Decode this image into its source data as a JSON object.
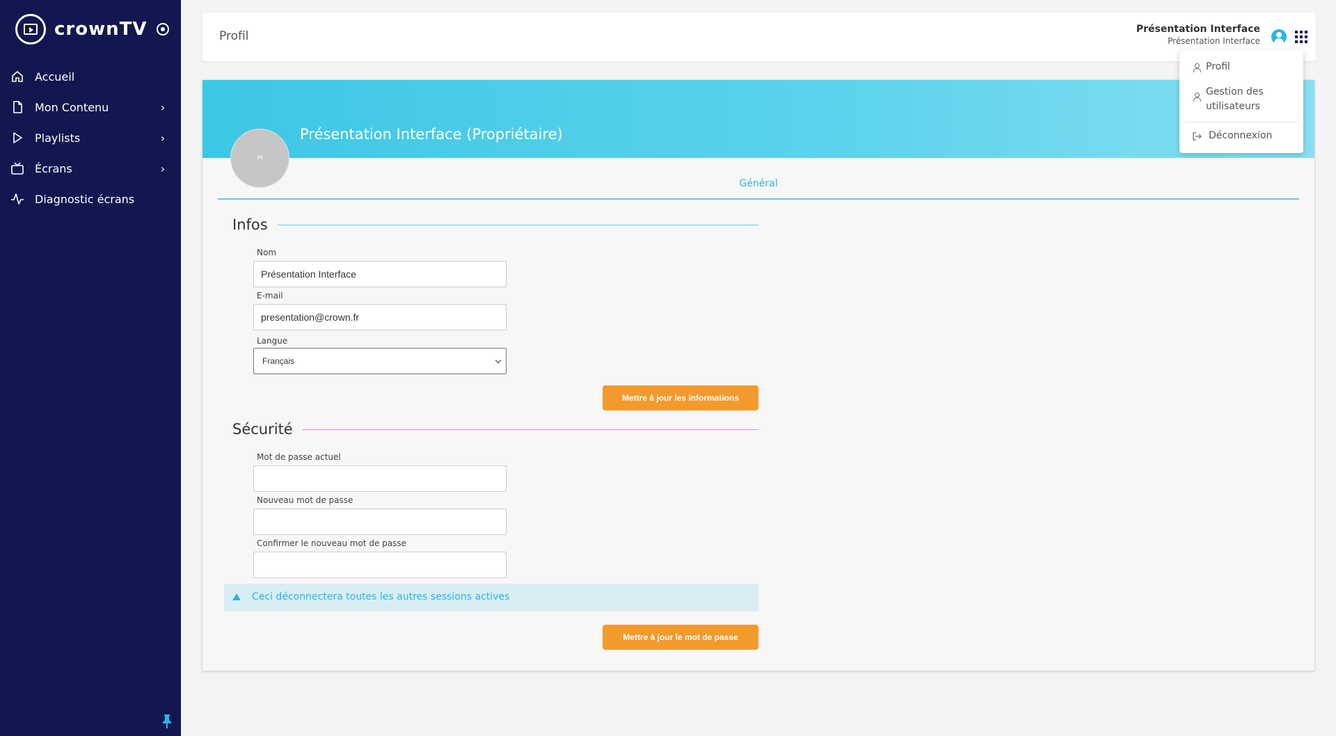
{
  "brand": {
    "name": "crownTV"
  },
  "sidebar": {
    "items": [
      {
        "label": "Accueil",
        "icon": "home-icon",
        "has_submenu": false
      },
      {
        "label": "Mon Contenu",
        "icon": "file-icon",
        "has_submenu": true
      },
      {
        "label": "Playlists",
        "icon": "play-icon",
        "has_submenu": true
      },
      {
        "label": "Écrans",
        "icon": "tv-icon",
        "has_submenu": true
      },
      {
        "label": "Diagnostic écrans",
        "icon": "activity-icon",
        "has_submenu": false
      }
    ],
    "chevron": "›"
  },
  "header": {
    "title": "Profil",
    "user_name": "Présentation Interface",
    "user_org": "Présentation Interface"
  },
  "profile": {
    "banner_title": "Présentation Interface (Propriétaire)",
    "avatar_initials": "PI",
    "tab_label": "Général"
  },
  "infos": {
    "title": "Infos",
    "name_label": "Nom",
    "name_value": "Présentation Interface",
    "email_label": "E-mail",
    "email_value": "presentation@crown.fr",
    "language_label": "Langue",
    "language_value": "Français",
    "submit_label": "Mettre à jour les informations"
  },
  "security": {
    "title": "Sécurité",
    "current_password_label": "Mot de passe actuel",
    "new_password_label": "Nouveau mot de passe",
    "confirm_password_label": "Confirmer le nouveau mot de passe",
    "warning_text": "Ceci déconnectera toutes les autres sessions actives",
    "submit_label": "Mettre à jour le mot de passe"
  },
  "user_menu": {
    "profile_label": "Profil",
    "users_label_line1": "Gestion des",
    "users_label_line2": "utilisateurs",
    "logout_label": "Déconnexion"
  },
  "colors": {
    "sidebar_bg": "#12174f",
    "accent": "#29b6e6",
    "button": "#f39a2c"
  }
}
